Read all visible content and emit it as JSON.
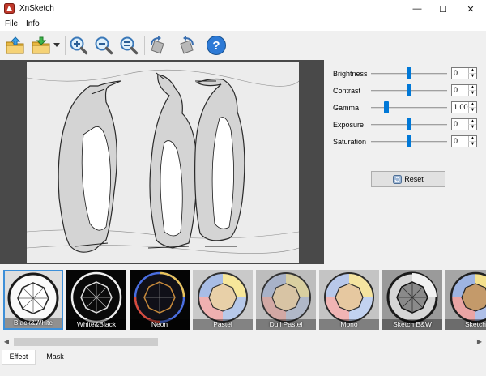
{
  "window": {
    "title": "XnSketch",
    "minimize_glyph": "—",
    "maximize_glyph": "☐",
    "close_glyph": "✕"
  },
  "menu": {
    "file": "File",
    "info": "Info"
  },
  "toolbar": {
    "icons": [
      "open-folder-icon",
      "save-folder-icon",
      "zoom-in-icon",
      "zoom-out-icon",
      "zoom-fit-icon",
      "rotate-left-icon",
      "rotate-right-icon",
      "help-icon"
    ],
    "help_glyph": "?"
  },
  "adjustments": {
    "brightness": {
      "label": "Brightness",
      "value": "0",
      "level": 0.5
    },
    "contrast": {
      "label": "Contrast",
      "value": "0",
      "level": 0.5
    },
    "gamma": {
      "label": "Gamma",
      "value": "1.00",
      "level": 0.2
    },
    "exposure": {
      "label": "Exposure",
      "value": "0",
      "level": 0.5
    },
    "saturation": {
      "label": "Saturation",
      "value": "0",
      "level": 0.5
    },
    "spin_up_glyph": "▲",
    "spin_down_glyph": "▼",
    "reset_label": "Reset"
  },
  "effects": [
    {
      "label": "Black&White",
      "selected": true
    },
    {
      "label": "White&Black",
      "selected": false
    },
    {
      "label": "Neon",
      "selected": false
    },
    {
      "label": "Pastel",
      "selected": false
    },
    {
      "label": "Dull Pastel",
      "selected": false
    },
    {
      "label": "Mono",
      "selected": false
    },
    {
      "label": "Sketch B&W",
      "selected": false
    },
    {
      "label": "Sketch",
      "selected": false
    }
  ],
  "scrollbar": {
    "left_glyph": "◀",
    "right_glyph": "▶"
  },
  "tabs": {
    "effect": "Effect",
    "mask": "Mask",
    "active": "Effect"
  },
  "colors": {
    "accent": "#0078d7",
    "selection": "#3d8fd8",
    "preview_bg": "#494949"
  }
}
